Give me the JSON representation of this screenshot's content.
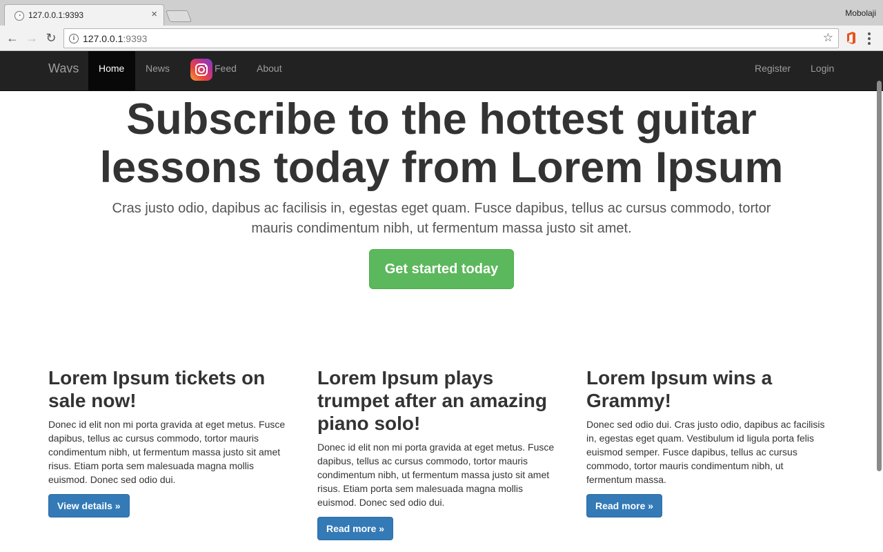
{
  "browser": {
    "tab_title": "127.0.0.1:9393",
    "profile_name": "Mobolaji",
    "url_host": "127.0.0.1",
    "url_port": ":9393"
  },
  "navbar": {
    "brand": "Wavs",
    "items": [
      {
        "label": "Home",
        "active": true
      },
      {
        "label": "News"
      },
      {
        "label": "Feed"
      },
      {
        "label": "About"
      }
    ],
    "right_items": [
      {
        "label": "Register"
      },
      {
        "label": "Login"
      }
    ]
  },
  "hero": {
    "title": "Subscribe to the hottest guitar lessons today from Lorem Ipsum",
    "lead": "Cras justo odio, dapibus ac facilisis in, egestas eget quam. Fusce dapibus, tellus ac cursus commodo, tortor mauris condimentum nibh, ut fermentum massa justo sit amet.",
    "cta_label": "Get started today"
  },
  "columns": [
    {
      "heading": "Lorem Ipsum tickets on sale now!",
      "body": "Donec id elit non mi porta gravida at eget metus. Fusce dapibus, tellus ac cursus commodo, tortor mauris condimentum nibh, ut fermentum massa justo sit amet risus. Etiam porta sem malesuada magna mollis euismod. Donec sed odio dui.",
      "button": "View details »"
    },
    {
      "heading": "Lorem Ipsum plays trumpet after an amazing piano solo!",
      "body": "Donec id elit non mi porta gravida at eget metus. Fusce dapibus, tellus ac cursus commodo, tortor mauris condimentum nibh, ut fermentum massa justo sit amet risus. Etiam porta sem malesuada magna mollis euismod. Donec sed odio dui.",
      "button": "Read more »"
    },
    {
      "heading": "Lorem Ipsum wins a Grammy!",
      "body": "Donec sed odio dui. Cras justo odio, dapibus ac facilisis in, egestas eget quam. Vestibulum id ligula porta felis euismod semper. Fusce dapibus, tellus ac cursus commodo, tortor mauris condimentum nibh, ut fermentum massa.",
      "button": "Read more »"
    }
  ],
  "colors": {
    "navbar_bg": "#222222",
    "cta_green": "#5cb85c",
    "primary_blue": "#337ab7"
  }
}
